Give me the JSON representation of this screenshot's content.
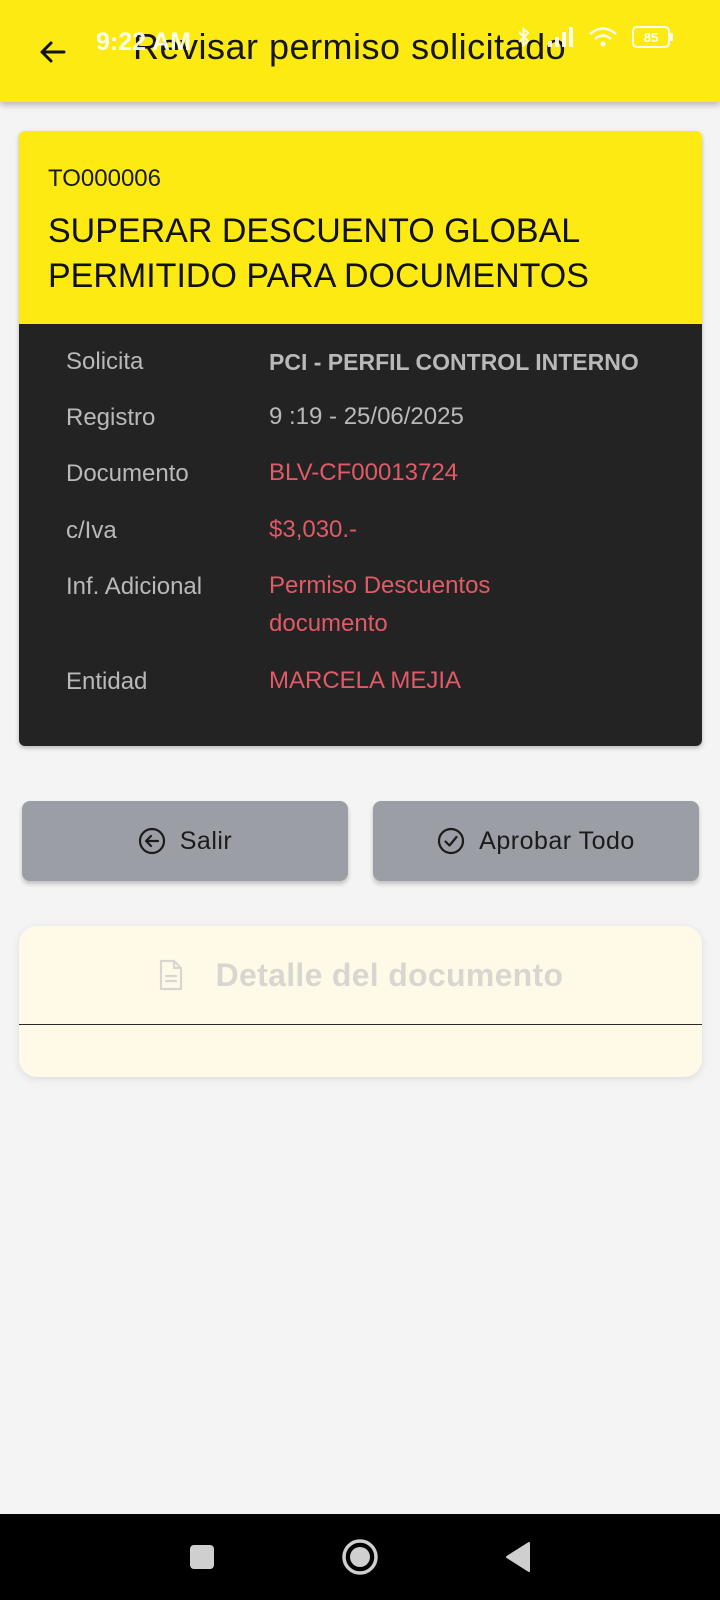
{
  "status_bar": {
    "time": "9:22 AM",
    "battery": "85"
  },
  "appbar": {
    "title": "Revisar permiso solicitado"
  },
  "permission": {
    "code": "TO000006",
    "title": "SUPERAR DESCUENTO GLOBAL PERMITIDO PARA DOCUMENTOS",
    "rows": [
      {
        "label": "Solicita",
        "value": "PCI - PERFIL CONTROL INTERNO"
      },
      {
        "label": "Registro",
        "value": "9 :19 - 25/06/2025"
      },
      {
        "label": "Documento",
        "value": "BLV-CF00013724"
      },
      {
        "label": "c/Iva",
        "value": "$3,030.-"
      },
      {
        "label": "Inf. Adicional",
        "value": "Permiso Descuentos documento"
      },
      {
        "label": "Entidad",
        "value": "MARCELA MEJIA"
      }
    ]
  },
  "actions": {
    "exit_label": "Salir",
    "approve_label": "Aprobar Todo"
  },
  "detail": {
    "title": "Detalle del documento"
  },
  "colors": {
    "accent": "#fdea12",
    "card_dark": "#232323",
    "value_red": "#e15a67",
    "button_gray": "#9c9ea5"
  }
}
